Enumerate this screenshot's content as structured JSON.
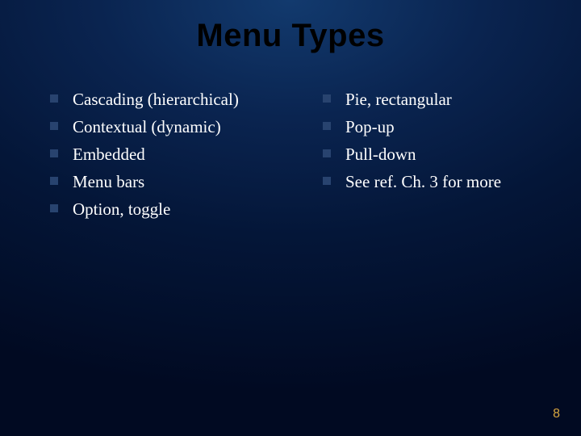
{
  "slide": {
    "title": "Menu Types",
    "page_number": "8",
    "columns": {
      "left": [
        "Cascading (hierarchical)",
        "Contextual (dynamic)",
        "Embedded",
        "Menu bars",
        "Option, toggle"
      ],
      "right": [
        "Pie, rectangular",
        "Pop-up",
        "Pull-down",
        "See ref. Ch. 3 for more"
      ]
    }
  }
}
